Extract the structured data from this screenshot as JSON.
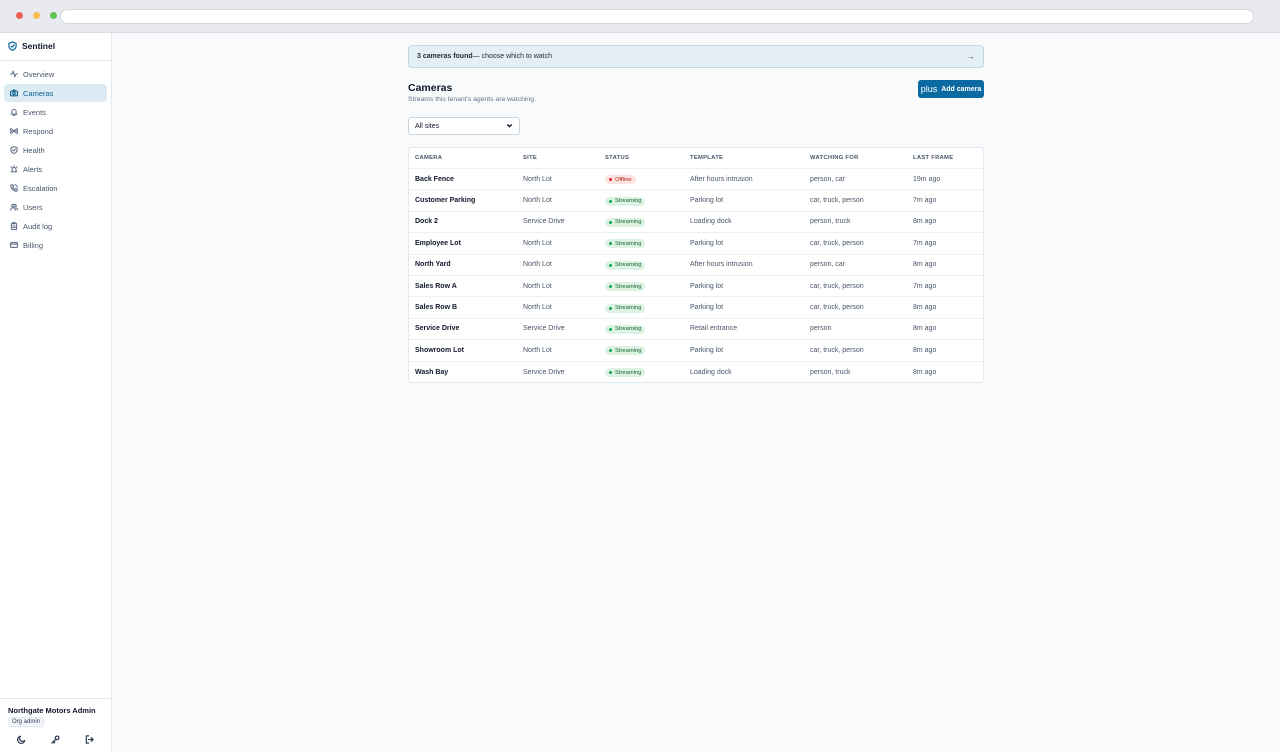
{
  "app": {
    "name": "Sentinel"
  },
  "sidebar": {
    "items": [
      {
        "label": "Overview",
        "icon": "activity-icon",
        "active": false
      },
      {
        "label": "Cameras",
        "icon": "camera-icon",
        "active": true
      },
      {
        "label": "Events",
        "icon": "bell-icon",
        "active": false
      },
      {
        "label": "Respond",
        "icon": "radio-icon",
        "active": false
      },
      {
        "label": "Health",
        "icon": "shield-check-icon",
        "active": false
      },
      {
        "label": "Alerts",
        "icon": "siren-icon",
        "active": false
      },
      {
        "label": "Escalation",
        "icon": "phone-icon",
        "active": false
      },
      {
        "label": "Users",
        "icon": "users-icon",
        "active": false
      },
      {
        "label": "Audit log",
        "icon": "clipboard-icon",
        "active": false
      },
      {
        "label": "Billing",
        "icon": "credit-card-icon",
        "active": false
      }
    ],
    "user": {
      "name": "Northgate Motors Admin",
      "role": "Org admin"
    }
  },
  "banner": {
    "count_text": "3 cameras found",
    "rest_text": " — choose which to watch",
    "arrow": "→"
  },
  "header": {
    "title": "Cameras",
    "subtitle": "Streams this tenant's agents are watching.",
    "add_label": "Add camera",
    "add_icon": "plus"
  },
  "filter": {
    "selected": "All sites"
  },
  "table": {
    "columns": [
      "Camera",
      "Site",
      "Status",
      "Template",
      "Watching for",
      "Last frame"
    ],
    "rows": [
      {
        "camera": "Back Fence",
        "site": "North Lot",
        "status": "Offline",
        "template": "After hours intrusion",
        "watching": "person, car",
        "last": "19m ago"
      },
      {
        "camera": "Customer Parking",
        "site": "North Lot",
        "status": "Streaming",
        "template": "Parking lot",
        "watching": "car, truck, person",
        "last": "7m ago"
      },
      {
        "camera": "Dock 2",
        "site": "Service Drive",
        "status": "Streaming",
        "template": "Loading dock",
        "watching": "person, truck",
        "last": "8m ago"
      },
      {
        "camera": "Employee Lot",
        "site": "North Lot",
        "status": "Streaming",
        "template": "Parking lot",
        "watching": "car, truck, person",
        "last": "7m ago"
      },
      {
        "camera": "North Yard",
        "site": "North Lot",
        "status": "Streaming",
        "template": "After hours intrusion",
        "watching": "person, car",
        "last": "8m ago"
      },
      {
        "camera": "Sales Row A",
        "site": "North Lot",
        "status": "Streaming",
        "template": "Parking lot",
        "watching": "car, truck, person",
        "last": "7m ago"
      },
      {
        "camera": "Sales Row B",
        "site": "North Lot",
        "status": "Streaming",
        "template": "Parking lot",
        "watching": "car, truck, person",
        "last": "8m ago"
      },
      {
        "camera": "Service Drive",
        "site": "Service Drive",
        "status": "Streaming",
        "template": "Retail entrance",
        "watching": "person",
        "last": "8m ago"
      },
      {
        "camera": "Showroom Lot",
        "site": "North Lot",
        "status": "Streaming",
        "template": "Parking lot",
        "watching": "car, truck, person",
        "last": "8m ago"
      },
      {
        "camera": "Wash Bay",
        "site": "Service Drive",
        "status": "Streaming",
        "template": "Loading dock",
        "watching": "person, truck",
        "last": "8m ago"
      }
    ]
  },
  "colors": {
    "accent": "#0b6aa2",
    "active_nav_bg": "#dbeaf3",
    "streaming": "#16a34a",
    "offline": "#dc2626"
  }
}
